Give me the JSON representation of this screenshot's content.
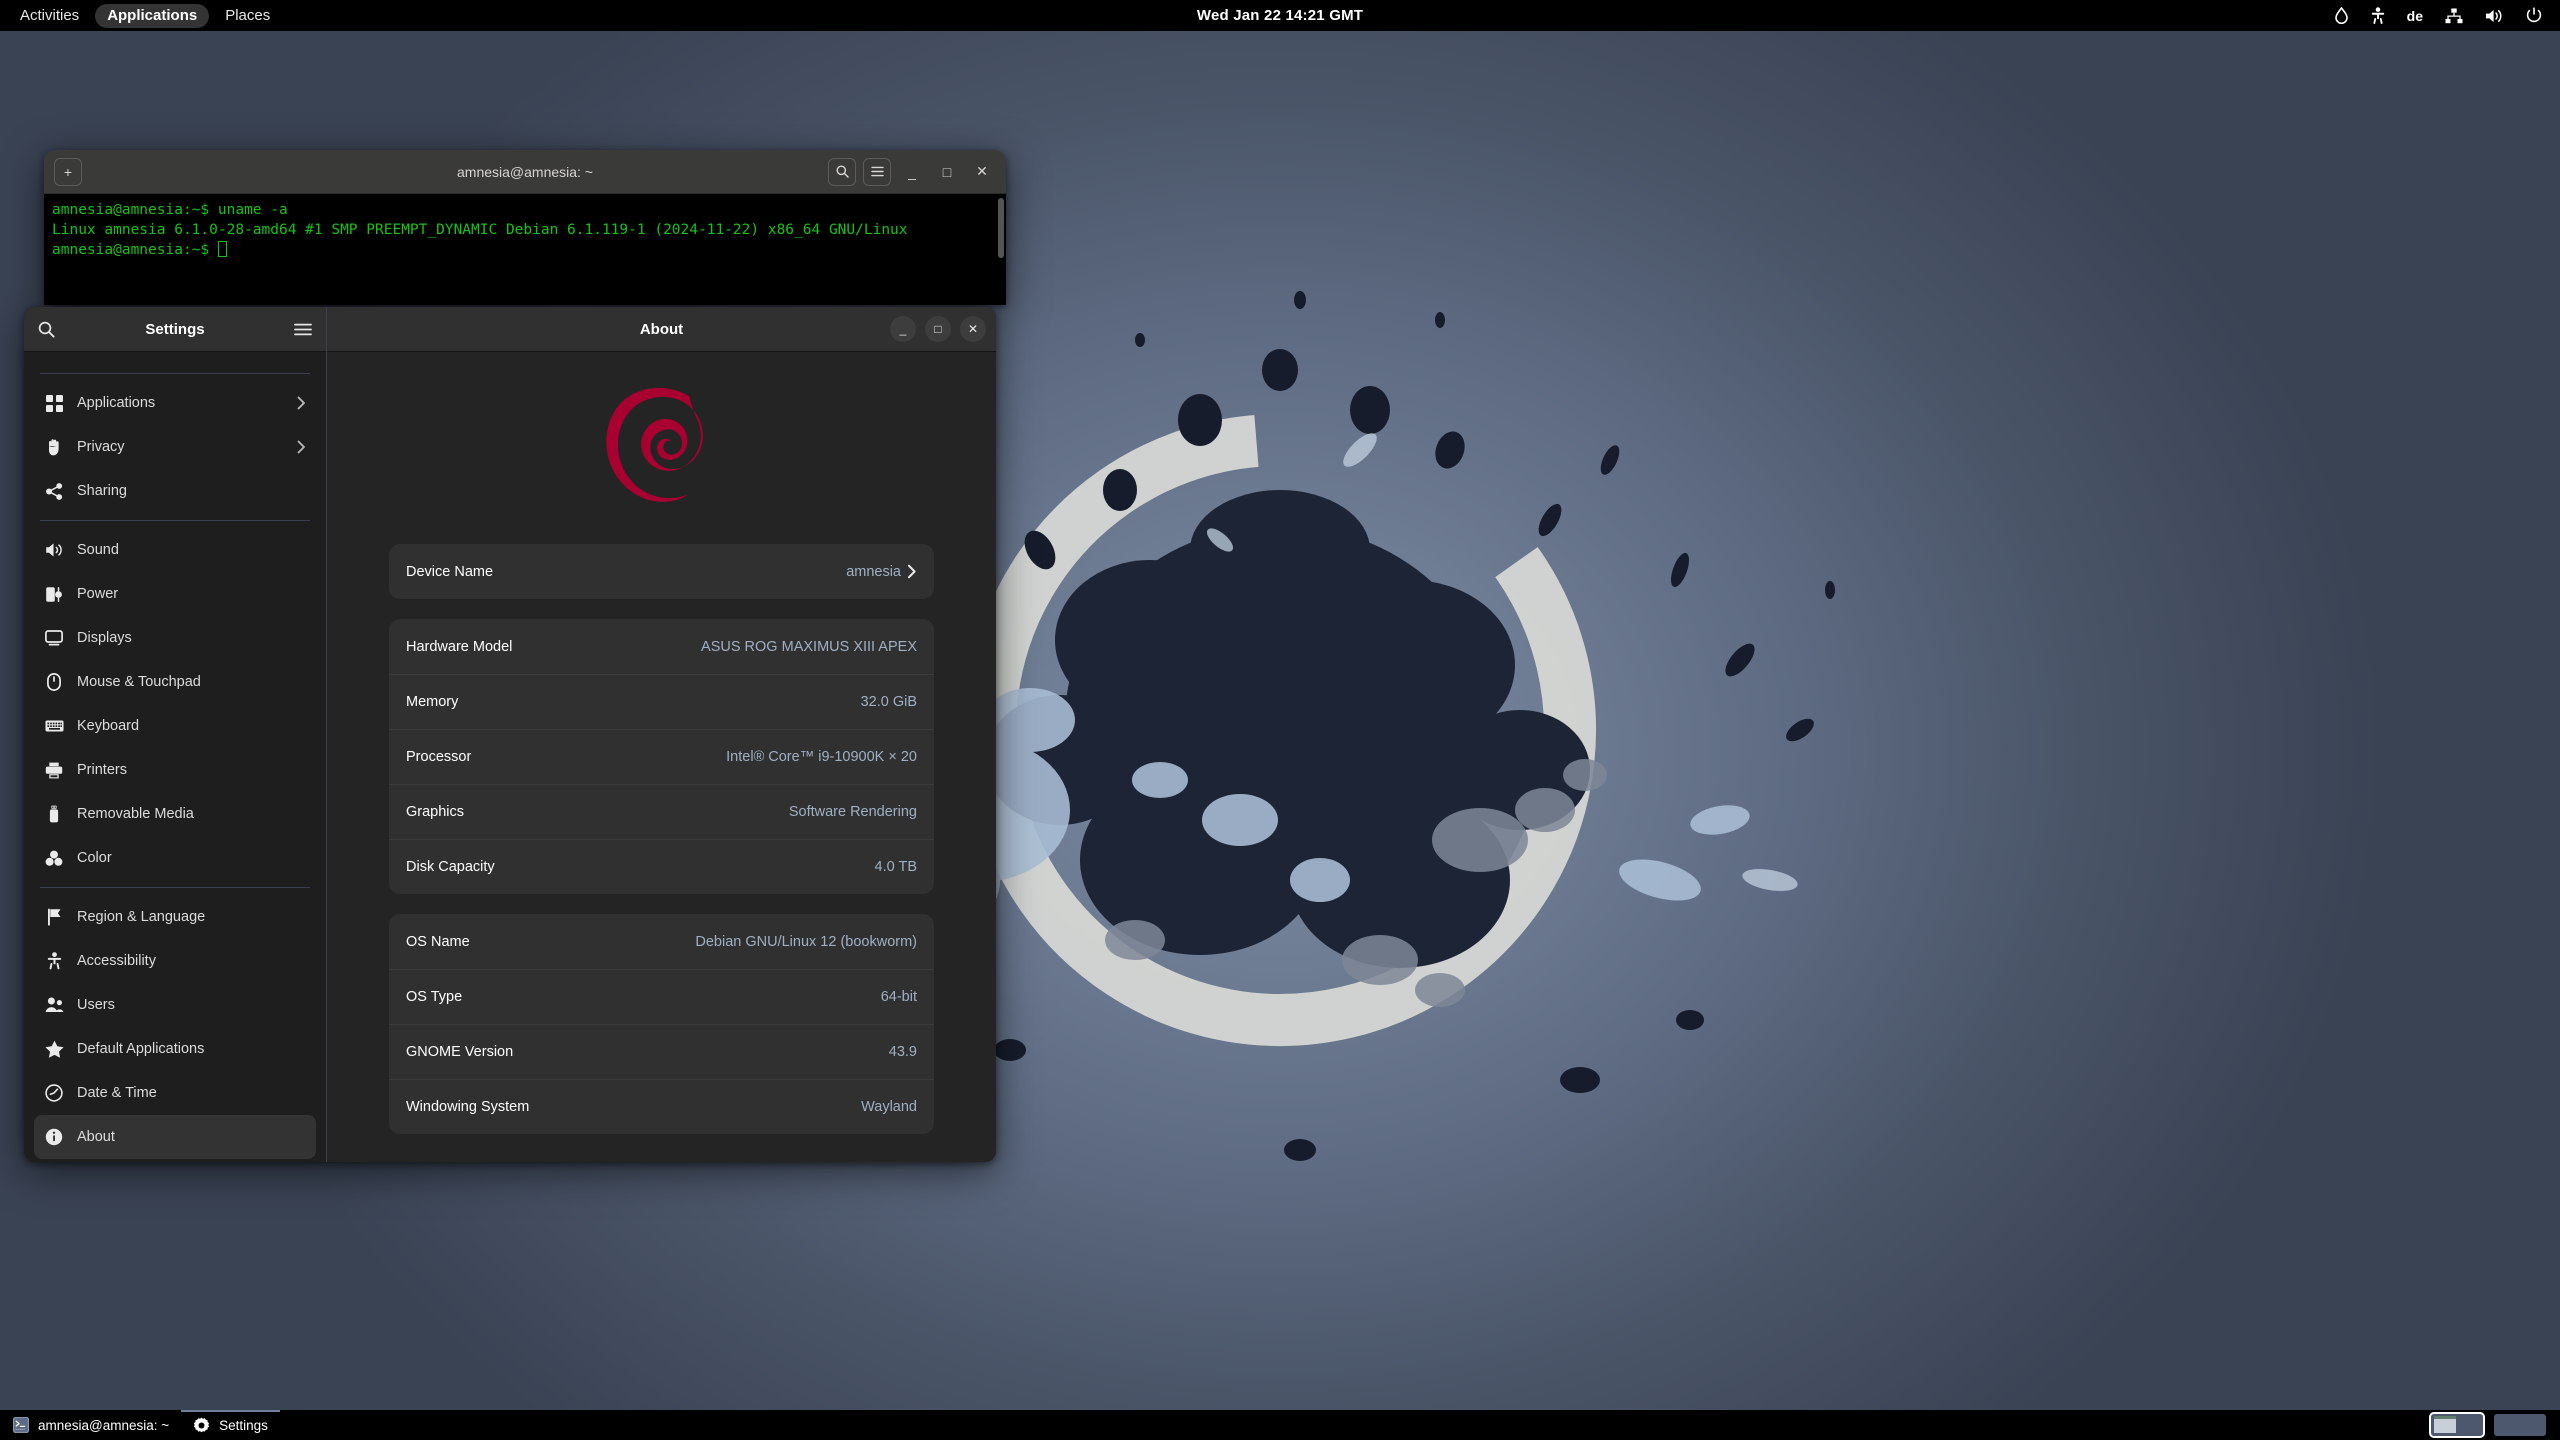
{
  "topbar": {
    "activities_label": "Activities",
    "applications_label": "Applications",
    "places_label": "Places",
    "clock": "Wed Jan 22  14:21 GMT",
    "night_light_icon": "water-drop-icon",
    "accessibility_icon": "accessibility-icon",
    "keyboard_layout": "de",
    "network_icon": "network-wired-icon",
    "volume_icon": "volume-icon",
    "power_icon": "power-icon"
  },
  "terminal": {
    "title": "amnesia@amnesia: ~",
    "new_tab_label": "+",
    "search_label": "Search",
    "menu_label": "Menu",
    "minimize_label": "_",
    "maximize_label": "□",
    "close_label": "✕",
    "lines": [
      {
        "prompt": "amnesia@amnesia:~$ ",
        "text": "uname -a"
      },
      {
        "prompt": "",
        "text": "Linux amnesia 6.1.0-28-amd64 #1 SMP PREEMPT_DYNAMIC Debian 6.1.119-1 (2024-11-22) x86_64 GNU/Linux"
      },
      {
        "prompt": "amnesia@amnesia:~$ ",
        "text": ""
      }
    ]
  },
  "settings": {
    "sidebar": {
      "title": "Settings",
      "search_label": "Search",
      "menu_label": "Main Menu",
      "groups": [
        {
          "items": [
            {
              "label": "Applications",
              "icon": "grid-icon",
              "chevron": "›"
            },
            {
              "label": "Privacy",
              "icon": "hand-icon",
              "chevron": "›"
            },
            {
              "label": "Sharing",
              "icon": "share-icon",
              "chevron": ""
            }
          ]
        },
        {
          "items": [
            {
              "label": "Sound",
              "icon": "speaker-icon",
              "chevron": ""
            },
            {
              "label": "Power",
              "icon": "power-plug-icon",
              "chevron": ""
            },
            {
              "label": "Displays",
              "icon": "monitor-icon",
              "chevron": ""
            },
            {
              "label": "Mouse & Touchpad",
              "icon": "mouse-icon",
              "chevron": ""
            },
            {
              "label": "Keyboard",
              "icon": "keyboard-icon",
              "chevron": ""
            },
            {
              "label": "Printers",
              "icon": "printer-icon",
              "chevron": ""
            },
            {
              "label": "Removable Media",
              "icon": "usb-icon",
              "chevron": ""
            },
            {
              "label": "Color",
              "icon": "color-icon",
              "chevron": ""
            }
          ]
        },
        {
          "items": [
            {
              "label": "Region & Language",
              "icon": "flag-icon",
              "chevron": ""
            },
            {
              "label": "Accessibility",
              "icon": "accessibility-icon",
              "chevron": ""
            },
            {
              "label": "Users",
              "icon": "users-icon",
              "chevron": ""
            },
            {
              "label": "Default Applications",
              "icon": "star-icon",
              "chevron": ""
            },
            {
              "label": "Date & Time",
              "icon": "clock-icon",
              "chevron": ""
            },
            {
              "label": "About",
              "icon": "info-icon",
              "chevron": "",
              "selected": true
            }
          ]
        }
      ]
    },
    "about": {
      "title": "About",
      "minimize_label": "_",
      "maximize_label": "□",
      "close_label": "✕",
      "logo_name": "debian-swirl-logo",
      "device": {
        "label": "Device Name",
        "value": "amnesia",
        "chevron": "›"
      },
      "hardware": [
        {
          "label": "Hardware Model",
          "value": "ASUS ROG MAXIMUS XIII APEX"
        },
        {
          "label": "Memory",
          "value": "32.0 GiB"
        },
        {
          "label": "Processor",
          "value": "Intel® Core™ i9-10900K × 20"
        },
        {
          "label": "Graphics",
          "value": "Software Rendering"
        },
        {
          "label": "Disk Capacity",
          "value": "4.0 TB"
        }
      ],
      "software": [
        {
          "label": "OS Name",
          "value": "Debian GNU/Linux 12 (bookworm)"
        },
        {
          "label": "OS Type",
          "value": "64-bit"
        },
        {
          "label": "GNOME Version",
          "value": "43.9"
        },
        {
          "label": "Windowing System",
          "value": "Wayland"
        }
      ]
    }
  },
  "taskbar": {
    "items": [
      {
        "label": "amnesia@amnesia: ~",
        "icon": "terminal-icon",
        "active": false
      },
      {
        "label": "Settings",
        "icon": "gear-icon",
        "active": true
      }
    ],
    "workspaces": [
      {
        "active": true,
        "has_window": true
      },
      {
        "active": false,
        "has_window": false
      }
    ]
  },
  "colors": {
    "debian_crimson": "#A80030",
    "terminal_green": "#17c217",
    "value_blue": "#9fb0c4",
    "selection_gray": "#333333"
  }
}
